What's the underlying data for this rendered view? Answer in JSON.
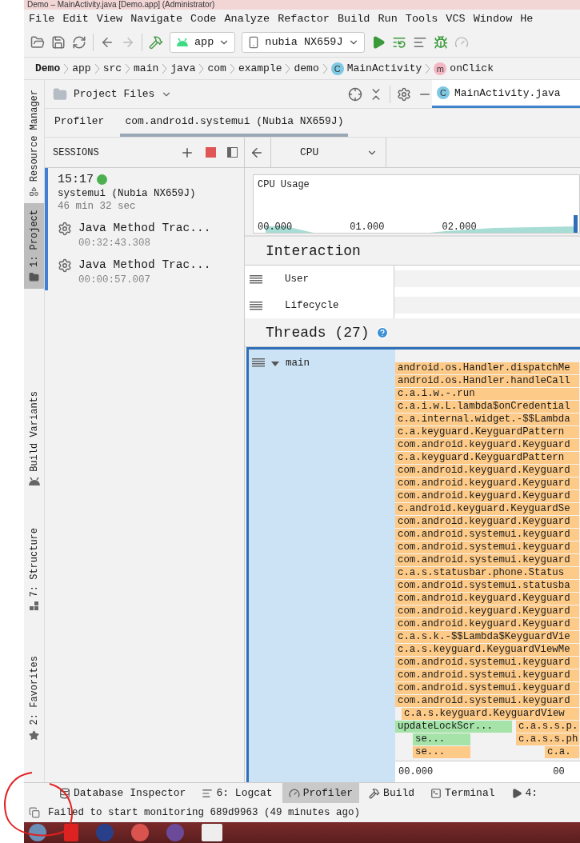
{
  "window": {
    "title": "Demo – MainActivity.java [Demo.app] (Administrator)"
  },
  "menu": [
    "File",
    "Edit",
    "View",
    "Navigate",
    "Code",
    "Analyze",
    "Refactor",
    "Build",
    "Run",
    "Tools",
    "VCS",
    "Window",
    "He"
  ],
  "toolbar": {
    "module": "app",
    "device": "nubia NX659J"
  },
  "breadcrumbs": [
    {
      "label": "Demo",
      "kind": "root"
    },
    {
      "label": "app",
      "kind": "plain"
    },
    {
      "label": "src",
      "kind": "plain"
    },
    {
      "label": "main",
      "kind": "plain"
    },
    {
      "label": "java",
      "kind": "plain"
    },
    {
      "label": "com",
      "kind": "plain"
    },
    {
      "label": "example",
      "kind": "plain"
    },
    {
      "label": "demo",
      "kind": "plain"
    },
    {
      "label": "MainActivity",
      "kind": "class",
      "badge": "C"
    },
    {
      "label": "onClick",
      "kind": "method",
      "badge": "m"
    }
  ],
  "project_panel": {
    "title": "Project Files"
  },
  "editor_tabs": [
    {
      "label": "MainActivity.java",
      "badge": "C",
      "selected": true
    }
  ],
  "tool_strip": [
    {
      "label": "Resource Manager",
      "selected": false
    },
    {
      "label": "1: Project",
      "selected": true
    },
    {
      "label": "Build Variants",
      "selected": false
    },
    {
      "label": "7: Structure",
      "selected": false
    },
    {
      "label": "2: Favorites",
      "selected": false
    }
  ],
  "profiler_tabs": [
    {
      "label": "Profiler",
      "selected": false
    },
    {
      "label": "com.android.systemui (Nubia NX659J)",
      "selected": true
    }
  ],
  "sessions": {
    "title": "SESSIONS",
    "items": [
      {
        "time": "15:17",
        "live": true,
        "selected": true,
        "name": "systemui (Nubia NX659J)",
        "duration": "46 min 32 sec",
        "captures": [
          {
            "title": "Java Method Trac...",
            "time": "00:32:43.308"
          },
          {
            "title": "Java Method Trac...",
            "time": "00:00:57.007"
          }
        ]
      }
    ]
  },
  "cpu": {
    "profiler": "CPU",
    "usage_title": "CPU Usage",
    "timeline": [
      "00.000",
      "01.000",
      "02.000"
    ]
  },
  "interaction": {
    "title": "Interaction",
    "tracks": [
      "User",
      "Lifecycle"
    ]
  },
  "threads": {
    "title": "Threads (27)",
    "items": [
      {
        "name": "main",
        "expanded": true,
        "selected": true
      }
    ],
    "frames": [
      {
        "kind": "system",
        "label": "android.os.Handler.dispatchMe"
      },
      {
        "kind": "system",
        "label": "android.os.Handler.handleCall"
      },
      {
        "kind": "system",
        "label": "c.a.i.w.-.run"
      },
      {
        "kind": "system",
        "label": "c.a.i.w.L.lambda$onCredential"
      },
      {
        "kind": "system",
        "label": "c.a.internal.widget.-$$Lambda"
      },
      {
        "kind": "system",
        "label": "c.a.keyguard.KeyguardPattern"
      },
      {
        "kind": "system",
        "label": "com.android.keyguard.Keyguard"
      },
      {
        "kind": "system",
        "label": "c.a.keyguard.KeyguardPattern"
      },
      {
        "kind": "system",
        "label": "com.android.keyguard.Keyguard"
      },
      {
        "kind": "system",
        "label": "com.android.keyguard.Keyguard"
      },
      {
        "kind": "system",
        "label": "com.android.keyguard.Keyguard"
      },
      {
        "kind": "system",
        "label": "c.android.keyguard.KeyguardSe"
      },
      {
        "kind": "system",
        "label": "com.android.keyguard.Keyguard"
      },
      {
        "kind": "system",
        "label": "com.android.systemui.keyguard"
      },
      {
        "kind": "system",
        "label": "com.android.systemui.keyguard"
      },
      {
        "kind": "system",
        "label": "com.android.systemui.keyguard"
      },
      {
        "kind": "system",
        "label": "c.a.s.statusbar.phone.Status"
      },
      {
        "kind": "system",
        "label": "com.android.systemui.statusba"
      },
      {
        "kind": "system",
        "label": "com.android.keyguard.Keyguard"
      },
      {
        "kind": "system",
        "label": "com.android.keyguard.Keyguard"
      },
      {
        "kind": "system",
        "label": "com.android.keyguard.Keyguard"
      },
      {
        "kind": "system",
        "label": "c.a.s.k.-$$Lambda$KeyguardVie"
      },
      {
        "kind": "system",
        "label": "c.a.s.keyguard.KeyguardViewMe"
      },
      {
        "kind": "system",
        "label": "com.android.systemui.keyguard"
      },
      {
        "kind": "system",
        "label": "com.android.systemui.keyguard"
      },
      {
        "kind": "system",
        "label": "com.android.systemui.keyguard"
      },
      {
        "kind": "system",
        "label": "com.android.systemui.keyguard"
      },
      {
        "kind": "offset",
        "label": "c.a.s.keyguard.KeyguardView"
      },
      {
        "kind": "split",
        "segments": [
          {
            "kind": "app",
            "label": "updateLockScr..."
          },
          {
            "kind": "system",
            "label": "c.a.s.s.p."
          }
        ]
      },
      {
        "kind": "split",
        "segments": [
          {
            "kind": "app",
            "label": "se..."
          },
          {
            "kind": "system",
            "label": "c.a.s.s.ph"
          }
        ]
      },
      {
        "kind": "split",
        "segments": [
          {
            "kind": "system",
            "label": "se..."
          },
          {
            "kind": "system",
            "label": "c.a."
          }
        ]
      }
    ],
    "axis": [
      "00.000",
      "00"
    ]
  },
  "bottom_tools": [
    {
      "label": "Database Inspector",
      "selected": false
    },
    {
      "label": "6: Logcat",
      "selected": false
    },
    {
      "label": "Profiler",
      "selected": true
    },
    {
      "label": "Build",
      "selected": false
    },
    {
      "label": "Terminal",
      "selected": false
    },
    {
      "label": "4:",
      "selected": false
    }
  ],
  "status": "Failed to start monitoring 689d9963 (49 minutes ago)"
}
